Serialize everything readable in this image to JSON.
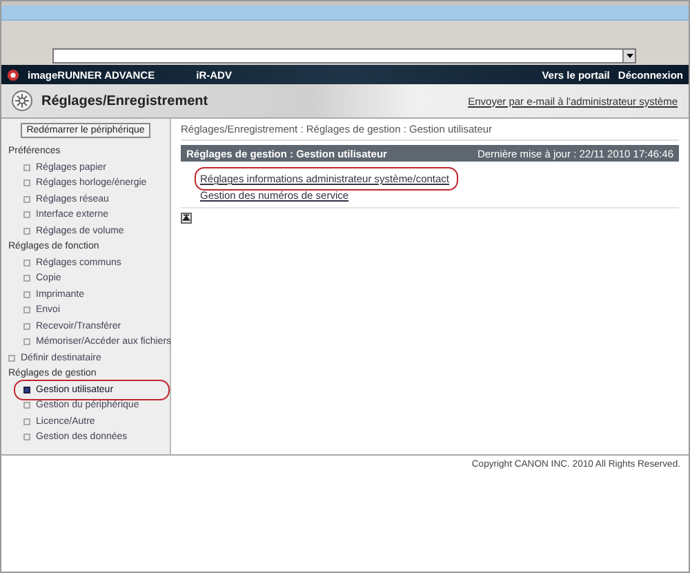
{
  "banner": {
    "product": "imageRUNNER ADVANCE",
    "device": "iR-ADV",
    "links": [
      "Vers le portail",
      "Déconnexion"
    ]
  },
  "title_bar": {
    "title": "Réglages/Enregistrement",
    "link": "Envoyer par e-mail à l'administrateur système"
  },
  "sidebar": {
    "button": "Redémarrer le périphérique",
    "items": [
      {
        "kind": "heading",
        "label": "Préférences",
        "children": [
          {
            "label": "Réglages papier",
            "selected": false,
            "highlighted": false
          },
          {
            "label": "Réglages horloge/énergie",
            "selected": false,
            "highlighted": false
          },
          {
            "label": "Réglages réseau",
            "selected": false,
            "highlighted": false
          },
          {
            "label": "Interface externe",
            "selected": false,
            "highlighted": false
          },
          {
            "label": "Réglages de volume",
            "selected": false,
            "highlighted": false
          }
        ]
      },
      {
        "kind": "heading",
        "label": "Réglages de fonction",
        "children": [
          {
            "label": "Réglages communs",
            "selected": false,
            "highlighted": false
          },
          {
            "label": "Copie",
            "selected": false,
            "highlighted": false
          },
          {
            "label": "Imprimante",
            "selected": false,
            "highlighted": false
          },
          {
            "label": "Envoi",
            "selected": false,
            "highlighted": false
          },
          {
            "label": "Recevoir/Transférer",
            "selected": false,
            "highlighted": false
          },
          {
            "label": "Mémoriser/Accéder aux fichiers",
            "selected": false,
            "highlighted": false
          }
        ]
      },
      {
        "kind": "link",
        "label": "Définir destinataire",
        "selected": false,
        "highlighted": false
      },
      {
        "kind": "heading",
        "label": "Réglages de gestion",
        "children": [
          {
            "label": "Gestion utilisateur",
            "selected": true,
            "highlighted": true
          },
          {
            "label": "Gestion du périphérique",
            "selected": false,
            "highlighted": false
          },
          {
            "label": "Licence/Autre",
            "selected": false,
            "highlighted": false
          },
          {
            "label": "Gestion des données",
            "selected": false,
            "highlighted": false
          }
        ]
      }
    ]
  },
  "content": {
    "breadcrumb": "Réglages/Enregistrement : Réglages de gestion : Gestion utilisateur",
    "header": {
      "title": "Réglages de gestion : Gestion utilisateur",
      "updated": "Dernière mise à jour : 22/11 2010 17:46:46"
    },
    "links": [
      {
        "label": "Réglages informations administrateur système/contact",
        "highlighted": true
      },
      {
        "label": "Gestion des numéros de service",
        "highlighted": false
      }
    ]
  },
  "footer": {
    "copyright": "Copyright CANON INC. 2010 All Rights Reserved."
  }
}
